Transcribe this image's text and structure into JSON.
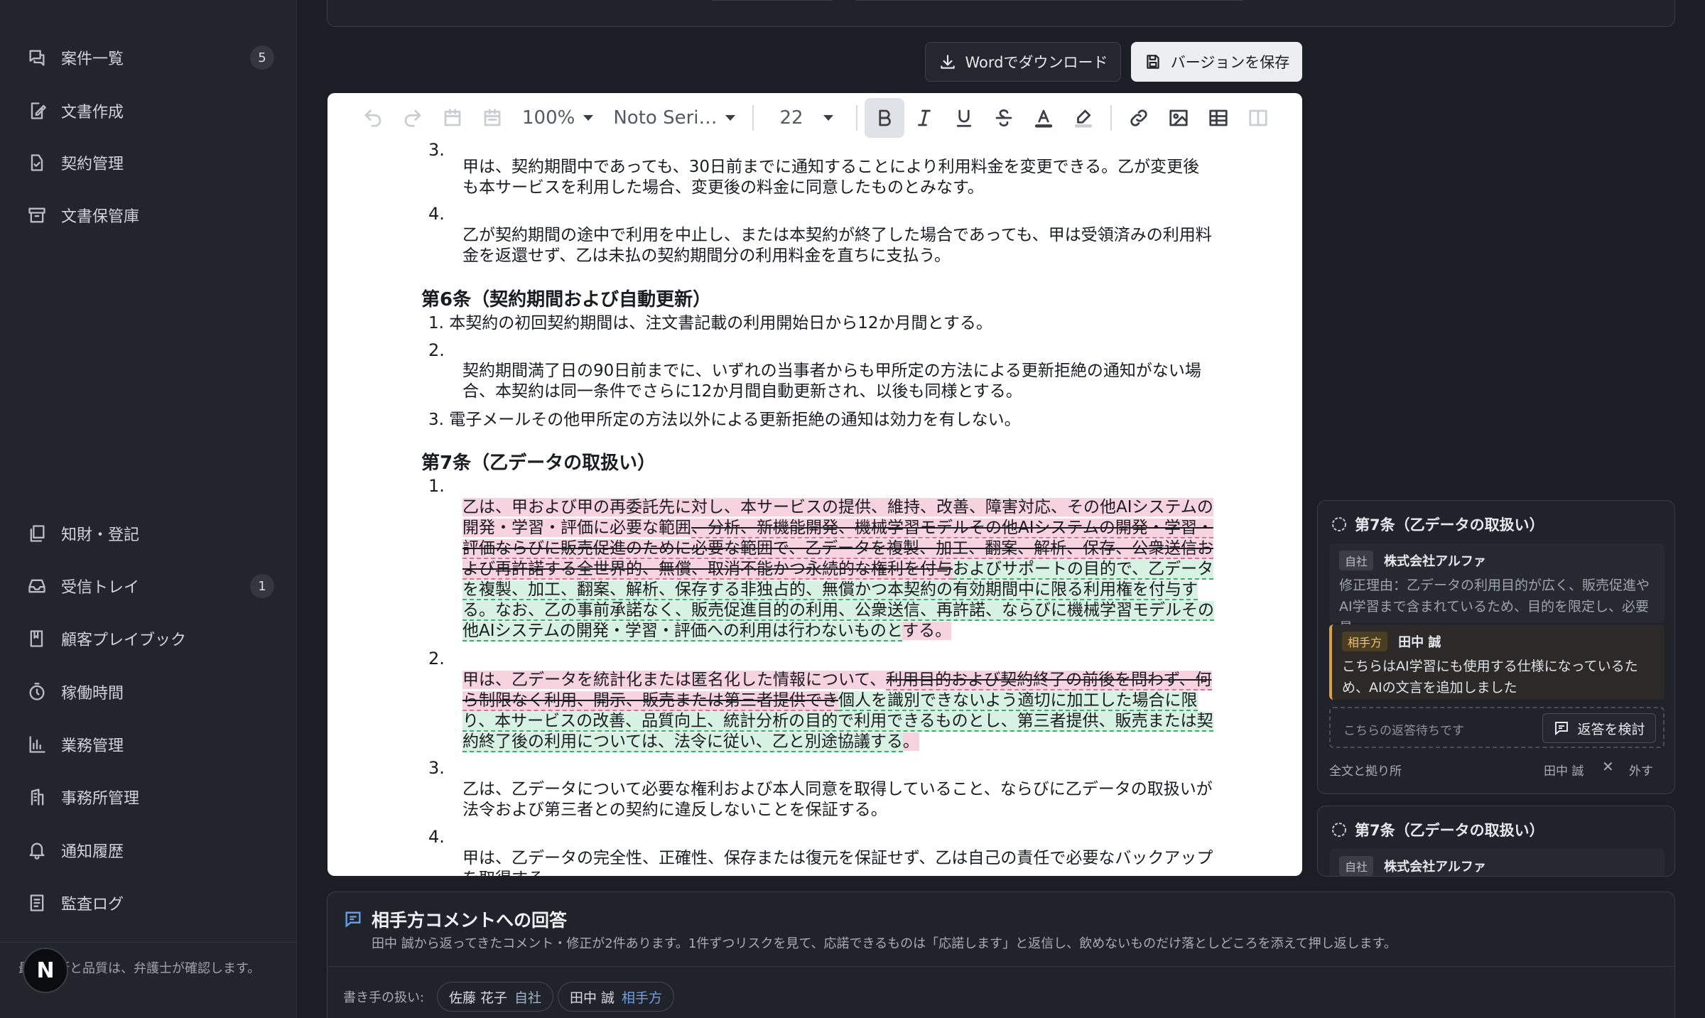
{
  "sidebar": {
    "items": [
      {
        "label": "案件一覧",
        "icon": "chat-list-icon",
        "count": "5"
      },
      {
        "label": "文書作成",
        "icon": "edit-document-icon"
      },
      {
        "label": "契約管理",
        "icon": "contract-icon"
      },
      {
        "label": "文書保管庫",
        "icon": "archive-icon"
      },
      {
        "label": "知財・登記",
        "icon": "copy-docs-icon"
      },
      {
        "label": "受信トレイ",
        "icon": "inbox-icon",
        "count": "1"
      },
      {
        "label": "顧客プレイブック",
        "icon": "book-icon"
      },
      {
        "label": "稼働時間",
        "icon": "timer-icon"
      },
      {
        "label": "業務管理",
        "icon": "bar-chart-icon"
      },
      {
        "label": "事務所管理",
        "icon": "building-icon"
      },
      {
        "label": "通知履歴",
        "icon": "bell-icon"
      },
      {
        "label": "監査ログ",
        "icon": "log-icon"
      }
    ],
    "footer_note": "最終判断と品質は、弁護士が確認します。",
    "avatar_letter": "N"
  },
  "actions": {
    "download_label": "Wordでダウンロード",
    "save_label": "バージョンを保存"
  },
  "toolbar": {
    "zoom": "100%",
    "font": "Noto Seri…",
    "size": "22"
  },
  "document": {
    "p5_3_num": "3.",
    "p5_3_text": "甲は、契約期間中であっても、30日前までに通知することにより利用料金を変更できる。乙が変更後も本サービスを利用した場合、変更後の料金に同意したものとみなす。",
    "p5_4_num": "4.",
    "p5_4_text": "乙が契約期間の途中で利用を中止し、または本契約が終了した場合であっても、甲は受領済みの利用料金を返還せず、乙は未払の契約期間分の利用料金を直ちに支払う。",
    "art6_heading": "第6条（契約期間および自動更新）",
    "p6_1": "1. 本契約の初回契約期間は、注文書記載の利用開始日から12か月間とする。",
    "p6_2_num": "2.",
    "p6_2_text": "契約期間満了日の90日前までに、いずれの当事者からも甲所定の方法による更新拒絶の通知がない場合、本契約は同一条件でさらに12か月間自動更新され、以後も同様とする。",
    "p6_3": "3. 電子メールその他甲所定の方法以外による更新拒絶の通知は効力を有しない。",
    "art7_heading": "第7条（乙データの取扱い）",
    "p7_1_num": "1.",
    "p7_1_a": "乙は、甲および甲の再委託先に対し、本サービスの提供、維持、改善、障害対応、その他AIシステムの開発・学習・評価に必要な範囲",
    "p7_1_del": "、分析、新機能開発、機械学習モデルその他AIシステムの開発・学習・評価ならびに販売促進のために必要な範囲で、乙データを複製、加工、翻案、解析、保存、公衆送信および再許諾する全世界的、無償、取消不能かつ永続的な権利を付与",
    "p7_1_ins": "およびサポートの目的で、乙データを複製、加工、翻案、解析、保存する非独占的、無償かつ本契約の有効期間中に限る利用権を付与する。なお、乙の事前承諾なく、販売促進目的の利用、公衆送信、再許諾、ならびに機械学習モデルその他AIシステムの開発・学習・評価への利用は行わないものと",
    "p7_1_end": "する。",
    "p7_2_num": "2.",
    "p7_2_a": "甲は、乙データを統計化または匿名化した情報について、",
    "p7_2_del": "利用目的および契約終了の前後を問わず、何ら制限なく利用、開示、販売または第三者提供でき",
    "p7_2_ins": "個人を識別できないよう適切に加工した場合に限り、本サービスの改善、品質向上、統計分析の目的で利用できるものとし、第三者提供、販売または契約終了後の利用については、法令に従い、乙と別途協議する",
    "p7_2_end": "。",
    "p7_3_num": "3.",
    "p7_3_text": "乙は、乙データについて必要な権利および本人同意を取得していること、ならびに乙データの取扱いが法令および第三者との契約に違反しないことを保証する。",
    "p7_4_num": "4.",
    "p7_4_text": "甲は、乙データの完全性、正確性、保存または復元を保証せず、乙は自己の責任で必要なバックアップを取得する。"
  },
  "comments": {
    "card1": {
      "title": "第7条（乙データの取扱い）",
      "own_tag": "自社",
      "own_author": "株式会社アルファ",
      "own_text": "修正理由：乙データの利用目的が広く、販売促進やAI学習まで含まれているため、目的を限定し、必要最…",
      "cp_tag": "相手方",
      "cp_author": "田中 誠",
      "cp_text": "こちらはAI学習にも使用する仕様になっているため、AIの文言を追加しました",
      "await_text": "こちらの返答待ちです",
      "reply_label": "返答を検討",
      "full_text_label": "全文と拠り所",
      "assignee": "田中 誠",
      "remove_label": "外す"
    },
    "card2": {
      "title": "第7条（乙データの取扱い）",
      "own_tag": "自社",
      "own_author": "株式会社アルファ"
    }
  },
  "bottom_panel": {
    "title": "相手方コメントへの回答",
    "description": "田中 誠から返ってきたコメント・修正が2件あります。1件ずつリスクを見て、応諾できるものは「応諾します」と返信し、飲めないものだけ落としどころを添えて押し返します。",
    "writer_label": "書き手の扱い:",
    "writers": [
      {
        "name": "佐藤 花子",
        "role": "自社"
      },
      {
        "name": "田中 誠",
        "role": "相手方"
      }
    ]
  }
}
